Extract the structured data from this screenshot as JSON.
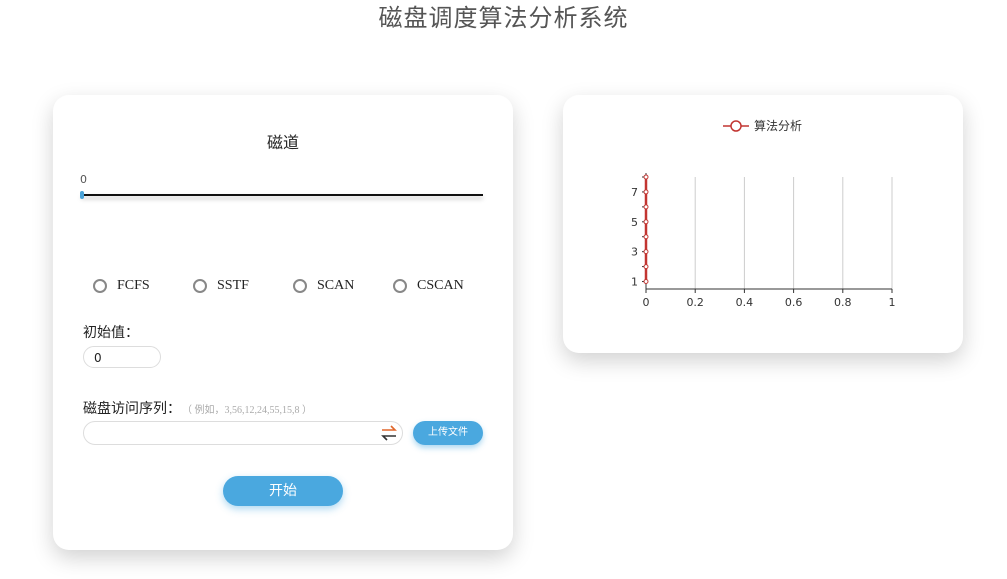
{
  "title": "磁盘调度算法分析系统",
  "left_panel": {
    "track_title": "磁道",
    "slider_value": "0",
    "algorithms": [
      {
        "label": "FCFS"
      },
      {
        "label": "SSTF"
      },
      {
        "label": "SCAN"
      },
      {
        "label": "CSCAN"
      }
    ],
    "initial_label": "初始值：",
    "initial_value": "0",
    "sequence_label": "磁盘访问序列：",
    "sequence_hint": "（ 例如，3,56,12,24,55,15,8 ）",
    "sequence_value": "",
    "swap_icon": "swap-arrows-icon",
    "upload_label": "上传文件",
    "start_label": "开始",
    "accent_color": "#4aa8df"
  },
  "chart_data": {
    "type": "line",
    "legend": [
      "算法分析"
    ],
    "legend_position": "top-center",
    "series": [
      {
        "name": "算法分析",
        "color": "#c23531",
        "x": [
          0,
          0,
          0,
          0,
          0,
          0,
          0,
          0
        ],
        "y": [
          1,
          2,
          3,
          4,
          5,
          6,
          7,
          8
        ]
      }
    ],
    "x_ticks": [
      "0",
      "0.2",
      "0.4",
      "0.6",
      "0.8",
      "1"
    ],
    "y_ticks": [
      "1",
      "3",
      "5",
      "7"
    ],
    "xlim": [
      0,
      1
    ],
    "ylim": [
      0.5,
      8
    ],
    "grid": "vertical"
  }
}
